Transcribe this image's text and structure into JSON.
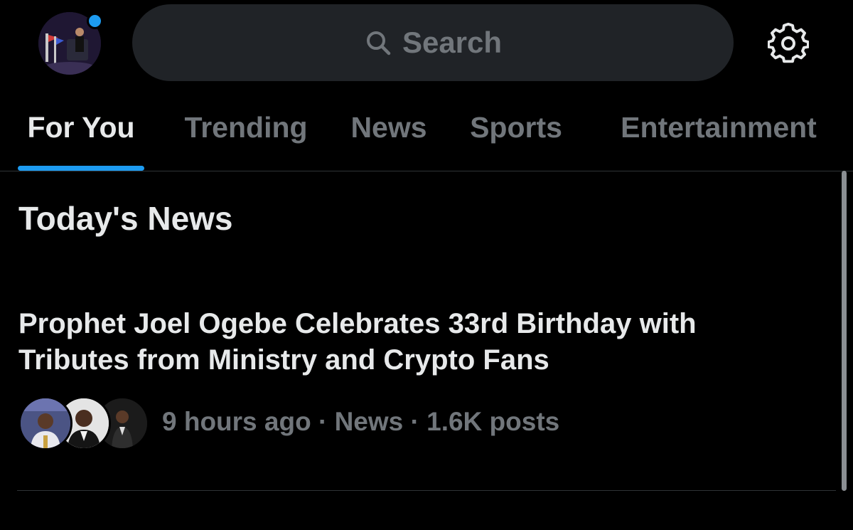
{
  "header": {
    "search_placeholder": "Search"
  },
  "tabs": [
    {
      "label": "For You",
      "active": true
    },
    {
      "label": "Trending",
      "active": false
    },
    {
      "label": "News",
      "active": false
    },
    {
      "label": "Sports",
      "active": false
    },
    {
      "label": "Entertainment",
      "active": false
    }
  ],
  "section": {
    "title": "Today's News"
  },
  "story": {
    "headline": "Prophet Joel Ogebe Celebrates 33rd Birthday with Tributes from Ministry and Crypto Fans",
    "meta": "9 hours ago · News · 1.6K posts"
  },
  "colors": {
    "background": "#000000",
    "accent": "#1d9bf0",
    "primary_text": "#e7e9ea",
    "secondary_text": "#71767b",
    "search_bg": "#202327",
    "divider": "#2f3336"
  },
  "icons": {
    "search": "search-icon",
    "settings": "gear-icon",
    "notification": "notification-dot-icon"
  }
}
